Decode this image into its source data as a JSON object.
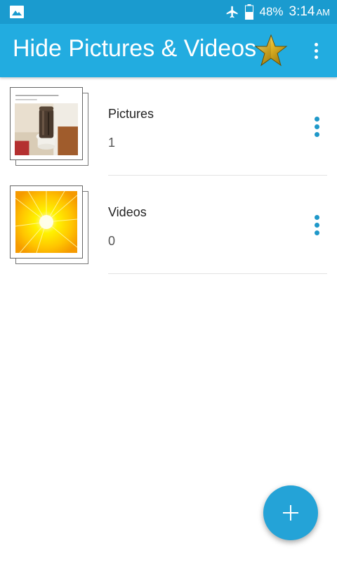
{
  "status_bar": {
    "battery": "48%",
    "time": "3:14",
    "ampm": "AM",
    "icons": [
      "gallery-notification-icon",
      "airplane-mode-icon",
      "battery-icon"
    ]
  },
  "app_bar": {
    "title": "Hide Pictures & Videos",
    "accent_color": "#22ace0",
    "icons": [
      "gold-star-icon",
      "overflow-menu-icon"
    ]
  },
  "folders": [
    {
      "title": "Pictures",
      "count": "1",
      "thumbnail": "toilet-photo-thumbnail"
    },
    {
      "title": "Videos",
      "count": "0",
      "thumbnail": "yellow-burst-thumbnail"
    }
  ],
  "fab": {
    "icon": "plus-icon",
    "color": "#24a3d7"
  }
}
